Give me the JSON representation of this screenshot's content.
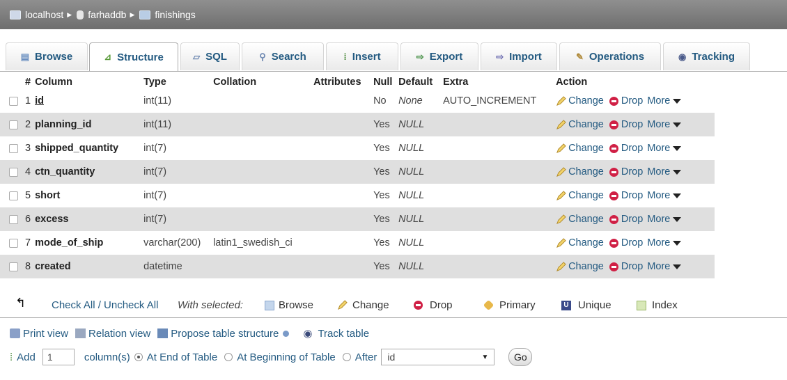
{
  "breadcrumb": {
    "server": "localhost",
    "database": "farhaddb",
    "table": "finishings"
  },
  "tabs": [
    {
      "label": "Browse",
      "icon": "browse-icon"
    },
    {
      "label": "Structure",
      "icon": "structure-icon",
      "active": true
    },
    {
      "label": "SQL",
      "icon": "sql-icon"
    },
    {
      "label": "Search",
      "icon": "search-icon"
    },
    {
      "label": "Insert",
      "icon": "insert-icon"
    },
    {
      "label": "Export",
      "icon": "export-icon"
    },
    {
      "label": "Import",
      "icon": "import-icon"
    },
    {
      "label": "Operations",
      "icon": "operations-icon"
    },
    {
      "label": "Tracking",
      "icon": "tracking-icon"
    }
  ],
  "table": {
    "headers": {
      "num": "#",
      "column": "Column",
      "type": "Type",
      "collation": "Collation",
      "attributes": "Attributes",
      "null": "Null",
      "default": "Default",
      "extra": "Extra",
      "action": "Action"
    },
    "rows": [
      {
        "num": "1",
        "name": "id",
        "type": "int(11)",
        "collation": "",
        "null": "No",
        "default": "None",
        "extra": "AUTO_INCREMENT"
      },
      {
        "num": "2",
        "name": "planning_id",
        "type": "int(11)",
        "collation": "",
        "null": "Yes",
        "default": "NULL",
        "extra": ""
      },
      {
        "num": "3",
        "name": "shipped_quantity",
        "type": "int(7)",
        "collation": "",
        "null": "Yes",
        "default": "NULL",
        "extra": ""
      },
      {
        "num": "4",
        "name": "ctn_quantity",
        "type": "int(7)",
        "collation": "",
        "null": "Yes",
        "default": "NULL",
        "extra": ""
      },
      {
        "num": "5",
        "name": "short",
        "type": "int(7)",
        "collation": "",
        "null": "Yes",
        "default": "NULL",
        "extra": ""
      },
      {
        "num": "6",
        "name": "excess",
        "type": "int(7)",
        "collation": "",
        "null": "Yes",
        "default": "NULL",
        "extra": ""
      },
      {
        "num": "7",
        "name": "mode_of_ship",
        "type": "varchar(200)",
        "collation": "latin1_swedish_ci",
        "null": "Yes",
        "default": "NULL",
        "extra": ""
      },
      {
        "num": "8",
        "name": "created",
        "type": "datetime",
        "collation": "",
        "null": "Yes",
        "default": "NULL",
        "extra": ""
      }
    ],
    "actions": {
      "change": "Change",
      "drop": "Drop",
      "more": "More"
    }
  },
  "selection": {
    "check_all": "Check All / Uncheck All",
    "with_selected": "With selected:",
    "browse": "Browse",
    "change": "Change",
    "drop": "Drop",
    "primary": "Primary",
    "unique": "Unique",
    "index": "Index"
  },
  "links": {
    "print_view": "Print view",
    "relation_view": "Relation view",
    "propose": "Propose table structure",
    "track_table": "Track table"
  },
  "add": {
    "label": "Add",
    "count": "1",
    "columns_text": "column(s)",
    "end": "At End of Table",
    "beginning": "At Beginning of Table",
    "after": "After",
    "after_value": "id",
    "go": "Go"
  },
  "colors": {
    "link": "#235a81",
    "drop": "#d02045",
    "row_alt": "#dfdfdf"
  }
}
